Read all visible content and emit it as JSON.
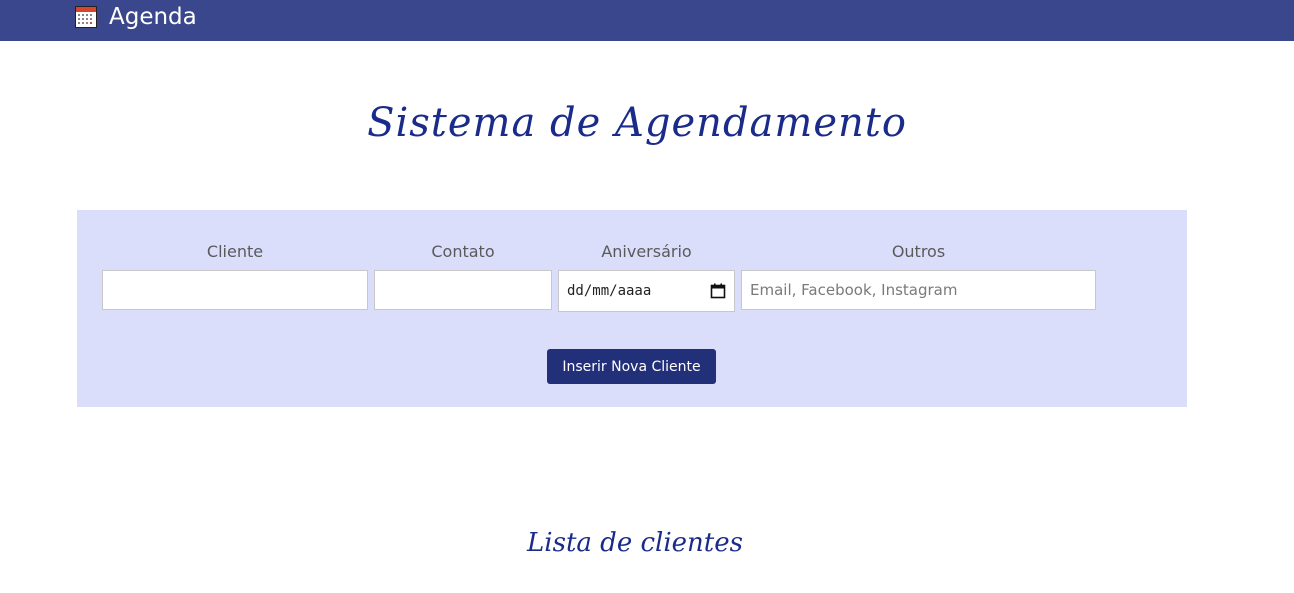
{
  "navbar": {
    "brand_label": "Agenda",
    "brand_icon": "calendar-icon",
    "background": "#3a478c"
  },
  "main": {
    "title": "Sistema de Agendamento"
  },
  "form": {
    "background": "#dadefb",
    "fields": [
      {
        "label": "Cliente",
        "value": "",
        "placeholder": ""
      },
      {
        "label": "Contato",
        "value": "",
        "placeholder": ""
      },
      {
        "label": "Aniversário",
        "value": "dd/mm/aaaa",
        "placeholder": ""
      },
      {
        "label": "Outros",
        "value": "",
        "placeholder": "Email, Facebook, Instagram"
      }
    ],
    "submit_label": "Inserir Nova Cliente",
    "submit_color": "#22307a"
  },
  "list": {
    "title": "Lista de clientes"
  }
}
